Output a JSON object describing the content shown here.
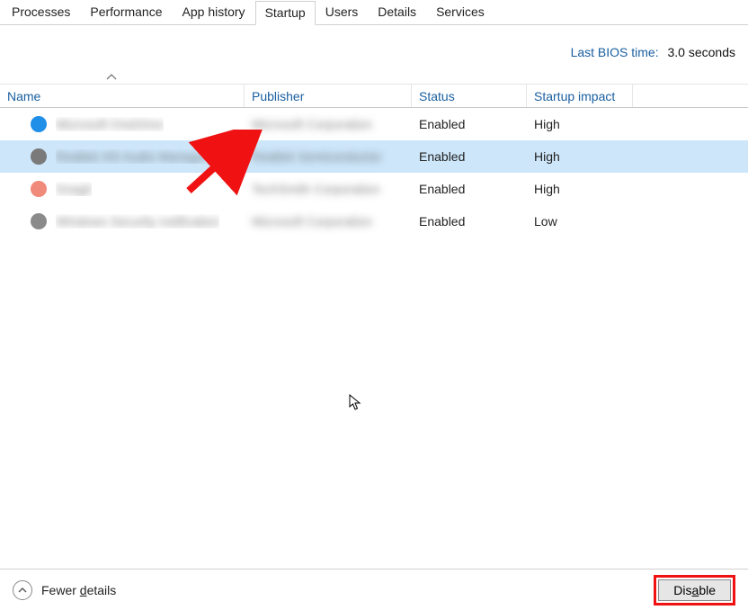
{
  "tabs": [
    {
      "label": "Processes",
      "active": false
    },
    {
      "label": "Performance",
      "active": false
    },
    {
      "label": "App history",
      "active": false
    },
    {
      "label": "Startup",
      "active": true
    },
    {
      "label": "Users",
      "active": false
    },
    {
      "label": "Details",
      "active": false
    },
    {
      "label": "Services",
      "active": false
    }
  ],
  "bios": {
    "label": "Last BIOS time:",
    "value": "3.0 seconds"
  },
  "columns": {
    "name": "Name",
    "publisher": "Publisher",
    "status": "Status",
    "impact": "Startup impact"
  },
  "rows": [
    {
      "icon_color": "#1f8fe8",
      "name_blur": "Microsoft OneDrive",
      "publisher_blur": "Microsoft Corporation",
      "status": "Enabled",
      "impact": "High",
      "selected": false
    },
    {
      "icon_color": "#7a7a7a",
      "name_blur": "Realtek HD Audio Manager",
      "publisher_blur": "Realtek Semiconductor",
      "status": "Enabled",
      "impact": "High",
      "selected": true
    },
    {
      "icon_color": "#f08a7a",
      "name_blur": "Snagit",
      "publisher_blur": "TechSmith Corporation",
      "status": "Enabled",
      "impact": "High",
      "selected": false
    },
    {
      "icon_color": "#8a8a8a",
      "name_blur": "Windows Security notification",
      "publisher_blur": "Microsoft Corporation",
      "status": "Enabled",
      "impact": "Low",
      "selected": false
    }
  ],
  "footer": {
    "fewer_pre": "Fewer ",
    "fewer_u": "d",
    "fewer_post": "etails",
    "disable_pre": "Dis",
    "disable_u": "a",
    "disable_post": "ble"
  },
  "annotations": {
    "arrow_color": "#f01212",
    "highlight_disable": true
  }
}
